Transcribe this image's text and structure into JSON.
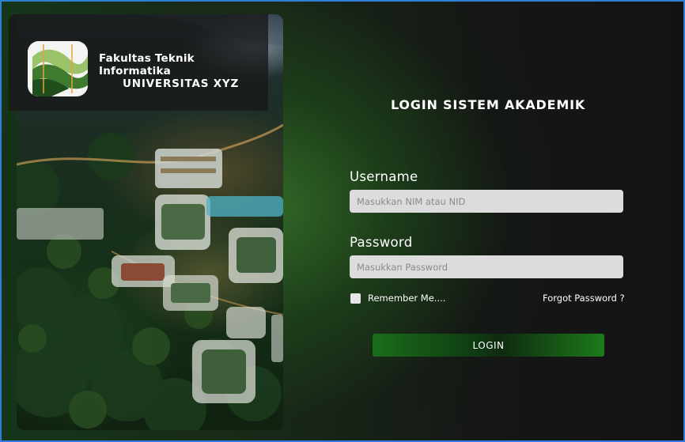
{
  "brand": {
    "faculty": "Fakultas Teknik Informatika",
    "university": "UNIVERSITAS XYZ",
    "logo_icon": "university-logo"
  },
  "form": {
    "title": "LOGIN SISTEM AKADEMIK",
    "username_label": "Username",
    "username_placeholder": "Masukkan NIM atau NID",
    "password_label": "Password",
    "password_placeholder": "Masukkan Password",
    "remember_label": "Remember Me....",
    "remember_checked": false,
    "forgot_label": "Forgot Password ?",
    "login_label": "LOGIN"
  },
  "colors": {
    "accent_green": "#1d7a1b",
    "frame_border": "#2f7fd6",
    "input_bg": "#dcdcdc"
  }
}
